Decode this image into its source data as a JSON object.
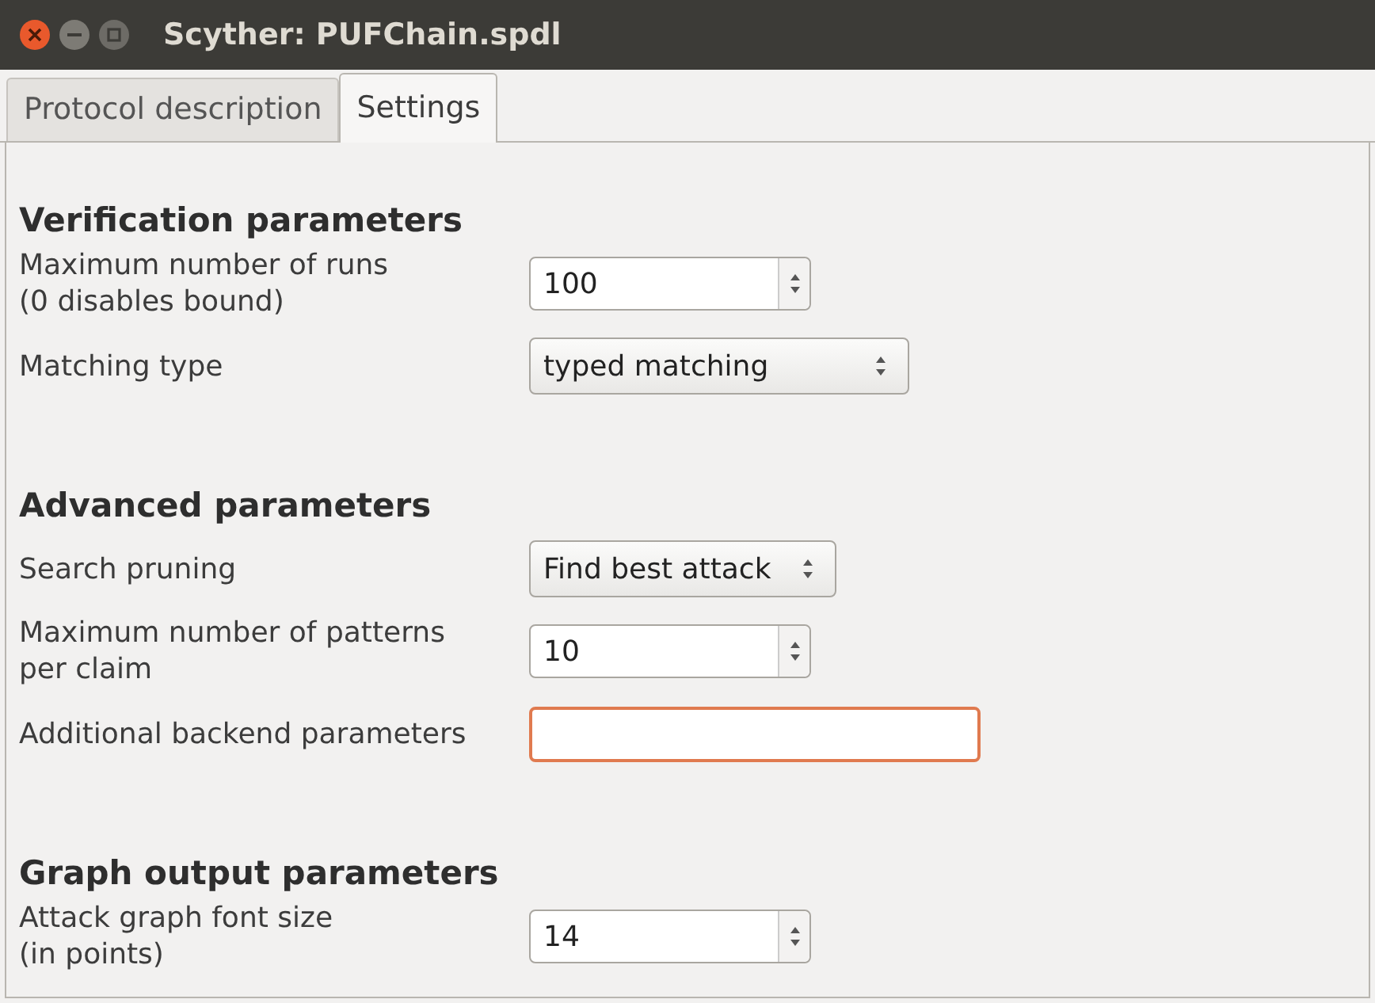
{
  "window": {
    "title": "Scyther: PUFChain.spdl"
  },
  "tabs": [
    {
      "label": "Protocol description",
      "selected": false
    },
    {
      "label": "Settings",
      "selected": true
    }
  ],
  "sections": [
    {
      "heading": "Verification parameters",
      "rows": [
        {
          "kind": "spin",
          "label": "Maximum number of runs\n(0 disables bound)",
          "value": "100"
        },
        {
          "kind": "combo",
          "label": "Matching type",
          "value": "typed matching"
        }
      ]
    },
    {
      "heading": "Advanced parameters",
      "rows": [
        {
          "kind": "combo",
          "label": "Search pruning",
          "value": "Find best attack"
        },
        {
          "kind": "spin",
          "label": "Maximum number of patterns\nper claim",
          "value": "10"
        },
        {
          "kind": "text",
          "label": "Additional backend parameters",
          "focused": true
        }
      ]
    },
    {
      "heading": "Graph output parameters",
      "rows": [
        {
          "kind": "spin",
          "label": "Attack graph font size\n(in points)",
          "value": "14"
        }
      ]
    }
  ]
}
